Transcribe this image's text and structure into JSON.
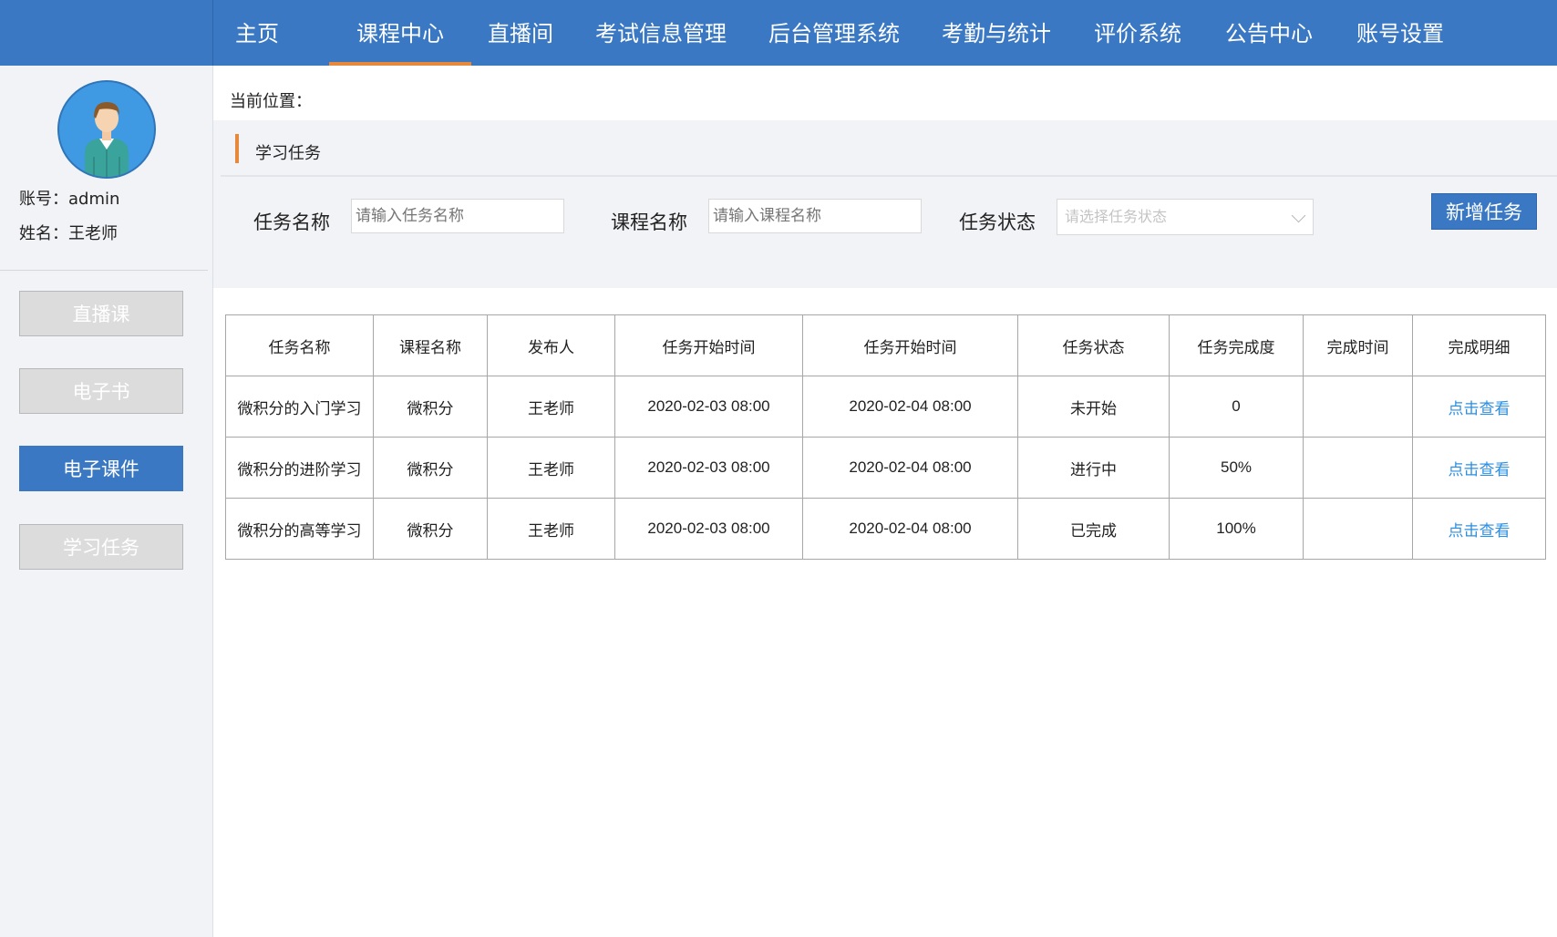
{
  "nav": {
    "items": [
      {
        "label": "主页"
      },
      {
        "label": "课程中心",
        "active": true
      },
      {
        "label": "直播间"
      },
      {
        "label": "考试信息管理"
      },
      {
        "label": "后台管理系统"
      },
      {
        "label": "考勤与统计"
      },
      {
        "label": "评价系统"
      },
      {
        "label": "公告中心"
      },
      {
        "label": "账号设置"
      }
    ],
    "accent_color": "#e8883a",
    "bg_color": "#3a78c3"
  },
  "sidebar": {
    "avatar_icon": "user-avatar-icon",
    "account_label": "账号：",
    "account_value": "admin",
    "name_label": "姓名：",
    "name_value": "王老师",
    "buttons": [
      {
        "label": "直播课"
      },
      {
        "label": "电子书"
      },
      {
        "label": "电子课件",
        "active": true
      },
      {
        "label": "学习任务"
      }
    ]
  },
  "breadcrumb": {
    "label": "当前位置："
  },
  "panel": {
    "title": "学习任务",
    "filters": {
      "task_name_label": "任务名称",
      "task_name_placeholder": "请输入任务名称",
      "course_name_label": "课程名称",
      "course_name_placeholder": "请输入课程名称",
      "status_label": "任务状态",
      "status_placeholder": "请选择任务状态"
    },
    "add_button": "新增任务"
  },
  "table": {
    "headers": [
      "任务名称",
      "课程名称",
      "发布人",
      "任务开始时间",
      "任务开始时间",
      "任务状态",
      "任务完成度",
      "完成时间",
      "完成明细"
    ],
    "rows": [
      {
        "task": "微积分的入门学习",
        "course": "微积分",
        "publisher": "王老师",
        "start": "2020-02-03 08:00",
        "start2": "2020-02-04 08:00",
        "status": "未开始",
        "progress": "0",
        "done_time": "",
        "detail": "点击查看"
      },
      {
        "task": "微积分的进阶学习",
        "course": "微积分",
        "publisher": "王老师",
        "start": "2020-02-03 08:00",
        "start2": "2020-02-04 08:00",
        "status": "进行中",
        "progress": "50%",
        "done_time": "",
        "detail": "点击查看"
      },
      {
        "task": "微积分的高等学习",
        "course": "微积分",
        "publisher": "王老师",
        "start": "2020-02-03 08:00",
        "start2": "2020-02-04 08:00",
        "status": "已完成",
        "progress": "100%",
        "done_time": "",
        "detail": "点击查看"
      }
    ]
  }
}
